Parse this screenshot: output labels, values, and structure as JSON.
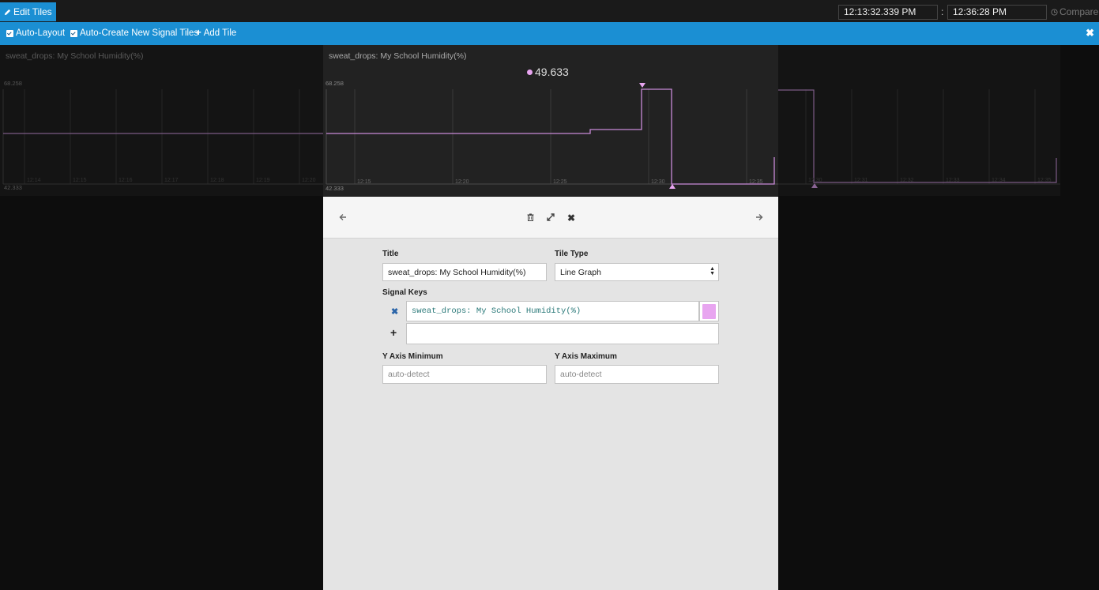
{
  "toolbar": {
    "edit_label": "Edit Tiles",
    "time_start": "12:13:32.339 PM",
    "time_separator": ":",
    "time_end": "12:36:28 PM",
    "compare_label": "Compare"
  },
  "subbar": {
    "auto_layout": "Auto-Layout",
    "auto_create": "Auto-Create New Signal Tiles",
    "add_tile": "Add Tile",
    "close_icon": "close-icon"
  },
  "tiles": {
    "left": {
      "title": "sweat_drops: My School Humidity(%)",
      "y_max": "68.258",
      "y_min": "42.333",
      "x_ticks": [
        "12:14",
        "12:15",
        "12:16",
        "12:17",
        "12:18",
        "12:19",
        "12:20"
      ]
    },
    "center": {
      "title": "sweat_drops: My School Humidity(%)",
      "y_max": "68.258",
      "y_min": "42.333",
      "readout": "49.633",
      "x_ticks": [
        "12:15",
        "12:20",
        "12:25",
        "12:30",
        "12:35"
      ]
    },
    "right": {
      "x_ticks": [
        "12:30",
        "12:31",
        "12:32",
        "12:33",
        "12:34",
        "12:35",
        "12:36"
      ]
    },
    "line_color": "#c98ad8"
  },
  "editor": {
    "title_label": "Title",
    "title_value": "sweat_drops: My School Humidity(%)",
    "tile_type_label": "Tile Type",
    "tile_type_value": "Line Graph",
    "signal_keys_label": "Signal Keys",
    "signal_key_value": "sweat_drops: My School Humidity(%)",
    "signal_key_color": "#e8a5f0",
    "y_min_label": "Y Axis Minimum",
    "y_min_placeholder": "auto-detect",
    "y_max_label": "Y Axis Maximum",
    "y_max_placeholder": "auto-detect"
  }
}
